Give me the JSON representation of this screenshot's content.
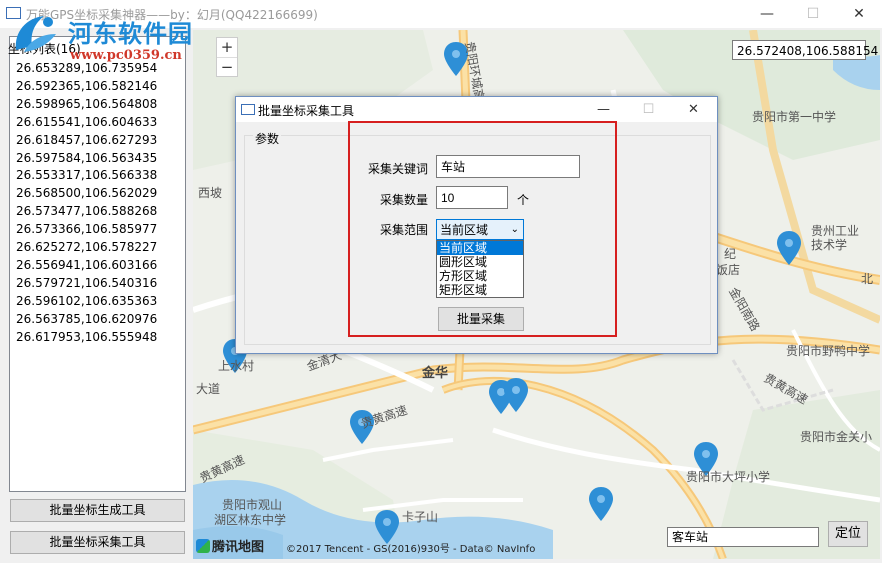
{
  "window": {
    "title": "万能GPS坐标采集神器——by：幻月(QQ422166699)",
    "minimize": "—",
    "maximize": "☐",
    "close": "✕"
  },
  "watermark": {
    "name": "河东软件园",
    "url": "www.pc0359.cn"
  },
  "coord_list": {
    "header": "坐标列表(16)",
    "items": [
      "26.653289,106.735954",
      "26.592365,106.582146",
      "26.598965,106.564808",
      "26.615541,106.604633",
      "26.618457,106.627293",
      "26.597584,106.563435",
      "26.553317,106.566338",
      "26.568500,106.562029",
      "26.573477,106.588268",
      "26.573366,106.585977",
      "26.625272,106.578227",
      "26.556941,106.603166",
      "26.579721,106.540316",
      "26.596102,106.635363",
      "26.563785,106.620976",
      "26.617953,106.555948"
    ]
  },
  "buttons": {
    "generate_tool": "批量坐标生成工具",
    "collect_tool": "批量坐标采集工具"
  },
  "map": {
    "coordinate": "26.572408,106.588154",
    "zoom_in": "+",
    "zoom_out": "−",
    "search_value": "客车站",
    "locate": "定位",
    "logo": "腾讯地图",
    "copyright": "©2017 Tencent - GS(2016)930号 - Data© NavInfo",
    "labels": {
      "l1": "贵阳市第一中学",
      "l2": "西坡",
      "l3": "贵州工业",
      "l4": "技术学",
      "l5": "纪",
      "l6": "饭店",
      "l7": "金阳南路",
      "l8": "北",
      "l9": "贵阳市野鸭中学",
      "l10": "上水村",
      "l11": "金清大",
      "l12": "金华",
      "l13": "贵黄高速",
      "l14": "贵黄高速",
      "l15": "贵阳市金关小",
      "l16": "贵阳市大坪小学",
      "l17": "贵阳市观山",
      "l18": "湖区林东中学",
      "l19": "卡子山",
      "l20": "贵黄高速",
      "l21": "贵阳环城高速",
      "l22": "大道"
    }
  },
  "dialog": {
    "title": "批量坐标采集工具",
    "group_label": "参数",
    "keyword_label": "采集关键词",
    "keyword_value": "车站",
    "count_label": "采集数量",
    "count_value": "10",
    "count_unit": "个",
    "range_label": "采集范围",
    "range_value": "当前区域",
    "range_options": [
      "当前区域",
      "圆形区域",
      "方形区域",
      "矩形区域"
    ],
    "collect_button": "批量采集",
    "minimize": "—",
    "maximize": "☐",
    "close": "✕"
  },
  "colors": {
    "marker": "#2e8fd6",
    "highlight_box": "#d61f1f",
    "selection": "#0078d7"
  }
}
